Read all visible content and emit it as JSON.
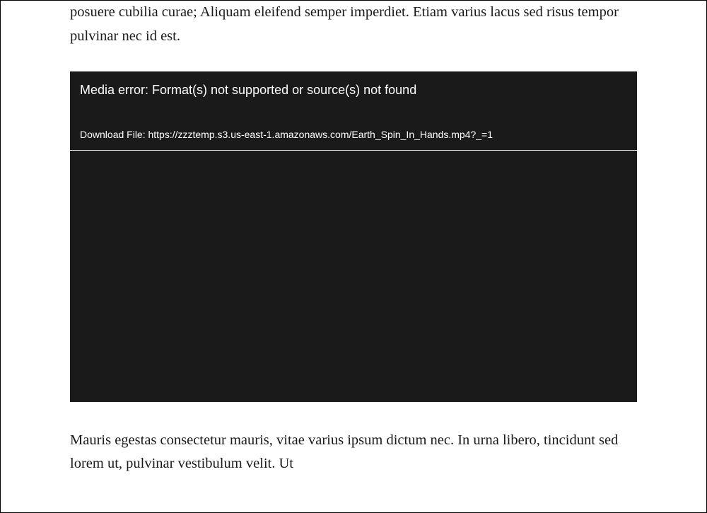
{
  "paragraph_top": "posuere cubilia curae; Aliquam eleifend semper imperdiet. Etiam varius lacus sed risus tempor pulvinar nec id est.",
  "paragraph_bottom": "Mauris egestas consectetur mauris, vitae varius ipsum dictum nec. In urna libero, tincidunt sed lorem ut, pulvinar vestibulum velit. Ut",
  "media_error": "Media error: Format(s) not supported or source(s) not found",
  "download_text": "Download File: https://zzztemp.s3.us-east-1.amazonaws.com/Earth_Spin_In_Hands.mp4?_=1"
}
